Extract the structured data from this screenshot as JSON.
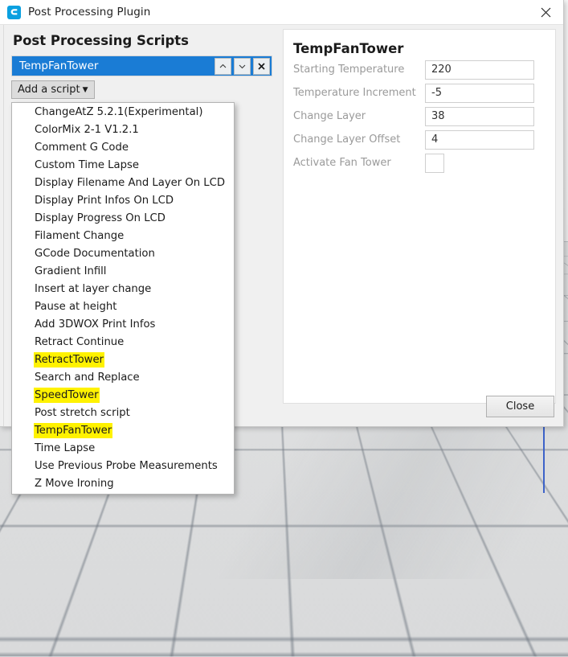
{
  "window": {
    "title": "Post Processing Plugin",
    "logo_icon": "cura-logo-icon",
    "close_icon": "close-icon"
  },
  "left_pane": {
    "heading": "Post Processing Scripts",
    "selected_script": "TempFanTower",
    "row_buttons": {
      "move_up_icon": "chevron-up-icon",
      "move_down_icon": "chevron-down-icon",
      "remove_icon": "close-icon"
    },
    "add_script_button": {
      "label": "Add a script",
      "caret_icon": "caret-down-icon"
    }
  },
  "dropdown": {
    "items": [
      {
        "label": "ChangeAtZ 5.2.1(Experimental)",
        "highlighted": false
      },
      {
        "label": "ColorMix 2-1 V1.2.1",
        "highlighted": false
      },
      {
        "label": "Comment G Code",
        "highlighted": false
      },
      {
        "label": "Custom Time Lapse",
        "highlighted": false
      },
      {
        "label": "Display Filename And Layer On LCD",
        "highlighted": false
      },
      {
        "label": "Display Print Infos On LCD",
        "highlighted": false
      },
      {
        "label": "Display Progress On LCD",
        "highlighted": false
      },
      {
        "label": "Filament Change",
        "highlighted": false
      },
      {
        "label": "GCode Documentation",
        "highlighted": false
      },
      {
        "label": "Gradient Infill",
        "highlighted": false
      },
      {
        "label": "Insert at layer change",
        "highlighted": false
      },
      {
        "label": "Pause at height",
        "highlighted": false
      },
      {
        "label": "Add 3DWOX Print Infos",
        "highlighted": false
      },
      {
        "label": "Retract Continue",
        "highlighted": false
      },
      {
        "label": "RetractTower",
        "highlighted": true
      },
      {
        "label": "Search and Replace",
        "highlighted": false
      },
      {
        "label": "SpeedTower",
        "highlighted": true
      },
      {
        "label": "Post stretch script",
        "highlighted": false
      },
      {
        "label": "TempFanTower",
        "highlighted": true
      },
      {
        "label": "Time Lapse",
        "highlighted": false
      },
      {
        "label": "Use Previous Probe Measurements",
        "highlighted": false
      },
      {
        "label": "Z Move Ironing",
        "highlighted": false
      }
    ]
  },
  "right_pane": {
    "heading": "TempFanTower",
    "fields": [
      {
        "label": "Starting Temperature",
        "value": "220",
        "type": "text"
      },
      {
        "label": "Temperature Increment",
        "value": "-5",
        "type": "text"
      },
      {
        "label": "Change Layer",
        "value": "38",
        "type": "text"
      },
      {
        "label": "Change Layer Offset",
        "value": "4",
        "type": "text"
      },
      {
        "label": "Activate Fan Tower",
        "value": "",
        "type": "checkbox",
        "checked": false
      }
    ]
  },
  "footer": {
    "close_label": "Close"
  },
  "colors": {
    "selection_blue": "#1a7cd5",
    "highlight_yellow": "#fff200",
    "dialog_bg": "#f0f0f0",
    "plate_line": "#6e7680",
    "plate_edge_blue": "#3d63c9"
  }
}
